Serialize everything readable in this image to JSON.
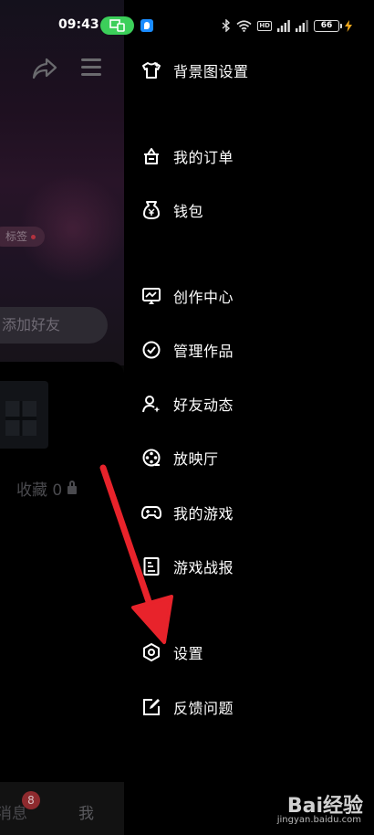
{
  "status_bar": {
    "time": "09:43",
    "battery": "66",
    "network_badge": "HD"
  },
  "background_page": {
    "tag": "标签",
    "add_friend": "添加好友",
    "collect_label": "收藏",
    "collect_count": "0",
    "bottom_nav": {
      "messages": "消息",
      "messages_badge": "8",
      "me": "我"
    }
  },
  "drawer": {
    "items": [
      {
        "label": "背景图设置",
        "icon": "tshirt-icon"
      },
      {
        "label": "我的订单",
        "icon": "order-icon"
      },
      {
        "label": "钱包",
        "icon": "wallet-icon"
      },
      {
        "label": "创作中心",
        "icon": "creator-icon"
      },
      {
        "label": "管理作品",
        "icon": "check-circle-icon"
      },
      {
        "label": "好友动态",
        "icon": "friend-activity-icon"
      },
      {
        "label": "放映厅",
        "icon": "film-reel-icon"
      },
      {
        "label": "我的游戏",
        "icon": "gamepad-icon"
      },
      {
        "label": "游戏战报",
        "icon": "report-icon"
      },
      {
        "label": "设置",
        "icon": "settings-hexagon-icon"
      },
      {
        "label": "反馈问题",
        "icon": "feedback-icon"
      }
    ]
  },
  "watermark": {
    "brand": "Bai经验",
    "url": "jingyan.baidu.com"
  },
  "colors": {
    "drawer_bg": "#000000",
    "arrow": "#e8232b",
    "cast_pill": "#3ccf5a"
  }
}
